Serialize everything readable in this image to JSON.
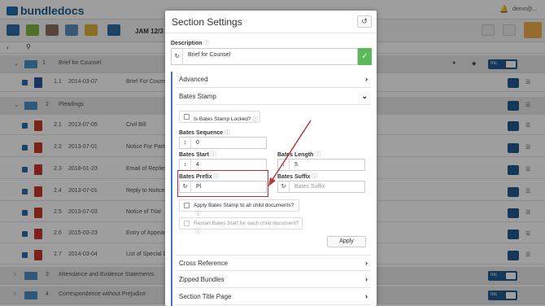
{
  "app": {
    "logo_text": "bundledocs",
    "user": "demo@...",
    "accent_color": "#1f5b8e"
  },
  "toolbar": {
    "bundle_label": "JAM 12/3"
  },
  "rows": [
    {
      "kind": "group",
      "num": "1",
      "title": "Brief for Counsel"
    },
    {
      "kind": "doc",
      "doctype": "word",
      "num": "1.1",
      "date": "2014-03-07",
      "title": "Brief For Counse"
    },
    {
      "kind": "group",
      "num": "2",
      "title": "Pleadings"
    },
    {
      "kind": "doc",
      "doctype": "pdf",
      "num": "2.1",
      "date": "2013-07-05",
      "title": "Civil Bill"
    },
    {
      "kind": "doc",
      "doctype": "pdf",
      "num": "2.2",
      "date": "2013-07-01",
      "title": "Notice For Partic"
    },
    {
      "kind": "doc",
      "doctype": "pdf",
      "num": "2.3",
      "date": "2018-01-23",
      "title": "Email of Replies"
    },
    {
      "kind": "doc",
      "doctype": "pdf",
      "num": "2.4",
      "date": "2013-07-01",
      "title": "Reply to Notice F"
    },
    {
      "kind": "doc",
      "doctype": "pdf",
      "num": "2.5",
      "date": "2013-07-03",
      "title": "Notice of Trial"
    },
    {
      "kind": "doc",
      "doctype": "pdf",
      "num": "2.6",
      "date": "2015-03-23",
      "title": "Entry of Appeara"
    },
    {
      "kind": "doc",
      "doctype": "pdf",
      "num": "2.7",
      "date": "2014-03-04",
      "title": "List of Special D"
    },
    {
      "kind": "group",
      "num": "3",
      "title": "Attendance and Evidence Statements"
    },
    {
      "kind": "group",
      "num": "4",
      "title": "Correspondence without Prejudice"
    }
  ],
  "inc_label": "Inc",
  "modal": {
    "title": "Section Settings",
    "history_icon": "history-icon",
    "description_label": "Description",
    "description_value": "Brief for Counsel",
    "sections": {
      "advanced": "Advanced",
      "bates_stamp": "Bates Stamp",
      "cross_reference": "Cross Reference",
      "zipped_bundles": "Zipped Bundles",
      "section_title_page": "Section Title Page"
    },
    "bates": {
      "locked_label": "Is Bates Stamp Locked?",
      "sequence_label": "Bates Sequence",
      "sequence_value": "0",
      "start_label": "Bates Start",
      "start_value": "4",
      "length_label": "Bates Length",
      "length_value": "5",
      "prefix_label": "Bates Prefix",
      "prefix_value": "Pl",
      "suffix_label": "Bates Suffix",
      "suffix_placeholder": "Bates Suffix",
      "apply_children_label": "Apply Bates Stamp to all child documents?",
      "restart_label": "Restart Bates Start for each child document?",
      "apply_button": "Apply"
    }
  }
}
